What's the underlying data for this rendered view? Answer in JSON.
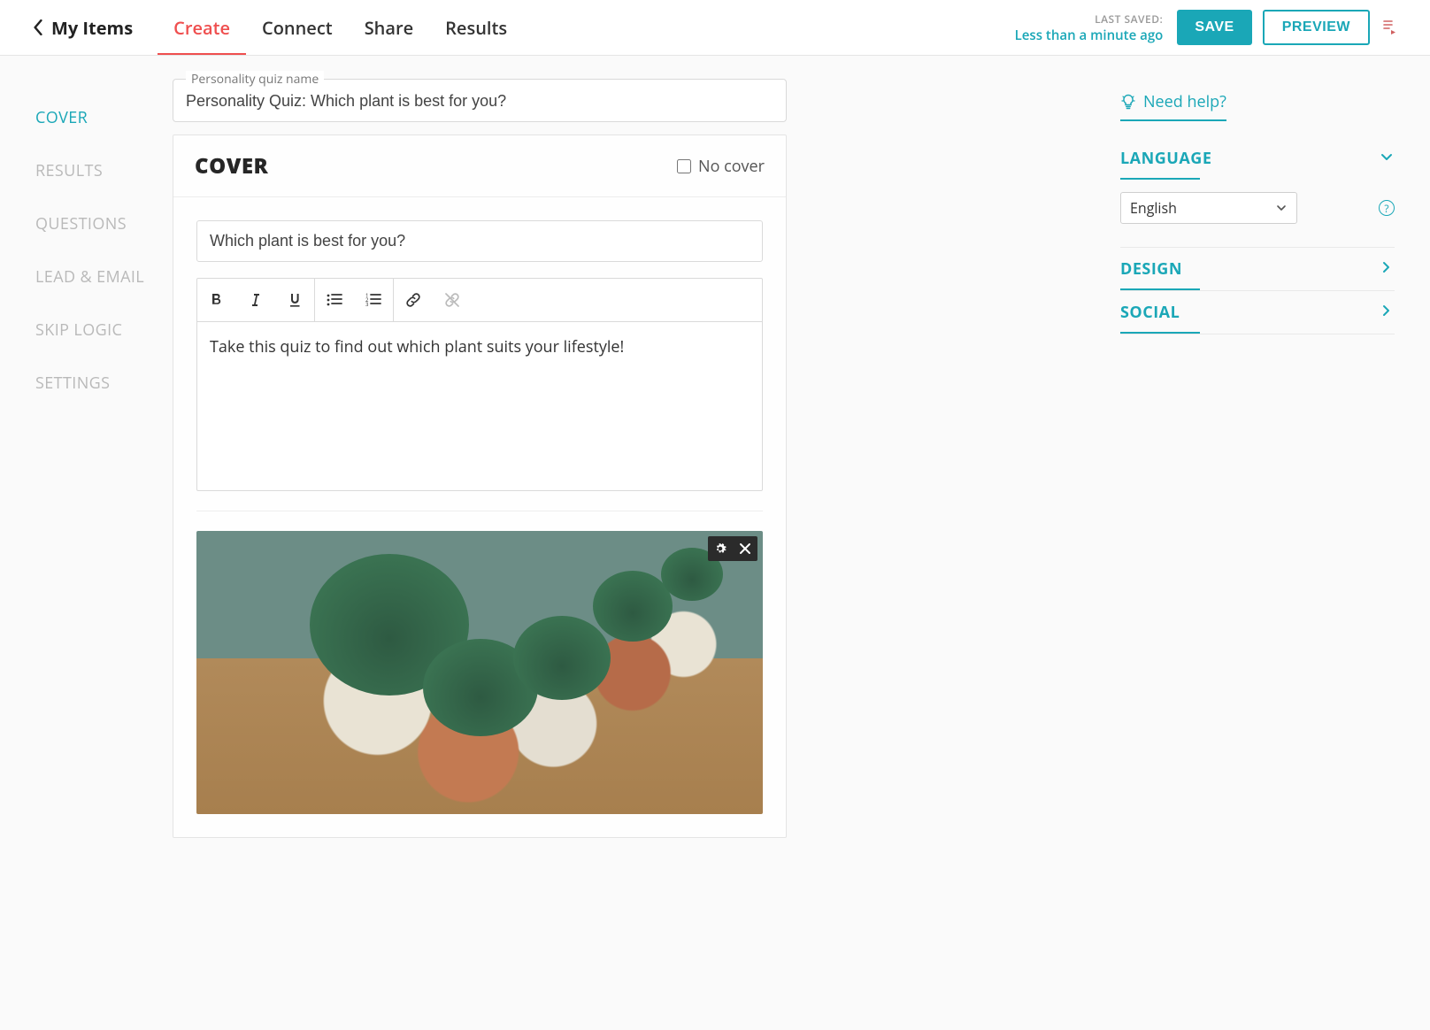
{
  "header": {
    "my_items": "My Items",
    "nav": [
      {
        "label": "Create",
        "active": true
      },
      {
        "label": "Connect",
        "active": false
      },
      {
        "label": "Share",
        "active": false
      },
      {
        "label": "Results",
        "active": false
      }
    ],
    "last_saved_label": "LAST SAVED:",
    "last_saved_value": "Less than a minute ago",
    "save_label": "SAVE",
    "preview_label": "PREVIEW"
  },
  "sidenav": [
    {
      "label": "COVER",
      "active": true
    },
    {
      "label": "RESULTS",
      "active": false
    },
    {
      "label": "QUESTIONS",
      "active": false
    },
    {
      "label": "LEAD & EMAIL",
      "active": false
    },
    {
      "label": "SKIP LOGIC",
      "active": false
    },
    {
      "label": "SETTINGS",
      "active": false
    }
  ],
  "editor": {
    "name_legend": "Personality quiz name",
    "name_value": "Personality Quiz: Which plant is best for you?",
    "section_title": "COVER",
    "no_cover_label": "No cover",
    "no_cover_checked": false,
    "title_value": "Which plant is best for you?",
    "description_value": "Take this quiz to find out which plant suits your lifestyle!"
  },
  "right": {
    "help_label": "Need help?",
    "accordion": [
      {
        "key": "LANGUAGE",
        "expanded": true
      },
      {
        "key": "DESIGN",
        "expanded": false
      },
      {
        "key": "SOCIAL",
        "expanded": false
      }
    ],
    "language_value": "English"
  }
}
